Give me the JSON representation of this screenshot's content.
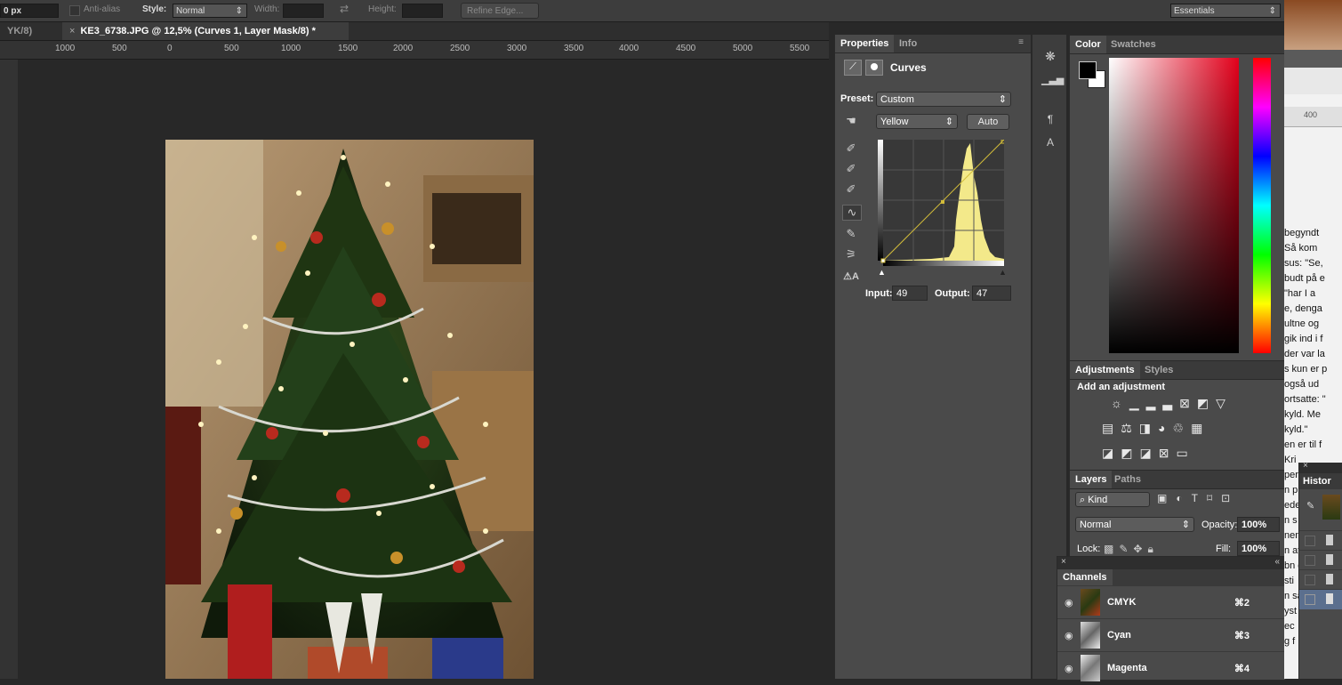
{
  "options_bar": {
    "px_label": "0 px",
    "antialias_label": "Anti-alias",
    "style_label": "Style:",
    "style_value": "Normal",
    "width_label": "Width:",
    "height_label": "Height:",
    "refine_edge_label": "Refine Edge...",
    "workspace": "Essentials"
  },
  "doc_tabs": {
    "prev_tab": "YK/8)",
    "active_tab": "KE3_6738.JPG @ 12,5% (Curves 1, Layer Mask/8) *"
  },
  "ruler_ticks": [
    "1000",
    "500",
    "0",
    "500",
    "1000",
    "1500",
    "2000",
    "2500",
    "3000",
    "3500",
    "4000",
    "4500",
    "5000",
    "5500"
  ],
  "properties": {
    "tabs": [
      "Properties",
      "Info"
    ],
    "adjustment_title": "Curves",
    "preset_label": "Preset:",
    "preset_value": "Custom",
    "channel_value": "Yellow",
    "auto_label": "Auto",
    "input_label": "Input:",
    "input_value": "49",
    "output_label": "Output:",
    "output_value": "47"
  },
  "color_panel": {
    "tabs": [
      "Color",
      "Swatches"
    ],
    "foreground": "#000000",
    "background": "#ffffff"
  },
  "adjustments_panel": {
    "tabs": [
      "Adjustments",
      "Styles"
    ],
    "heading": "Add an adjustment"
  },
  "layers_panel": {
    "tabs": [
      "Layers",
      "Paths"
    ],
    "filter_value": "Kind",
    "blend_mode": "Normal",
    "opacity_label": "Opacity:",
    "opacity_value": "100%",
    "lock_label": "Lock:",
    "fill_label": "Fill:",
    "fill_value": "100%"
  },
  "channels_panel": {
    "title": "Channels",
    "rows": [
      {
        "name": "CMYK",
        "shortcut": "⌘2"
      },
      {
        "name": "Cyan",
        "shortcut": "⌘3"
      },
      {
        "name": "Magenta",
        "shortcut": "⌘4"
      }
    ]
  },
  "history_panel": {
    "title": "Histor"
  },
  "background_doc": {
    "ruler_value": "400",
    "lines": [
      " begyndt",
      "Så kom",
      "sus: \"Se,",
      "budt på e",
      " \"har I a",
      "e, denga",
      "ultne og",
      "gik ind i f",
      "der var la",
      "s kun er p",
      "også ud",
      "ortsatte: \"",
      "kyld. Me",
      "kyld.\"",
      "en er til f",
      "Kri",
      "per",
      "n p",
      "ede",
      "n s",
      "nen",
      "n at",
      "bn d",
      "sti",
      "n sa",
      "yst",
      "ec",
      "g f"
    ]
  }
}
